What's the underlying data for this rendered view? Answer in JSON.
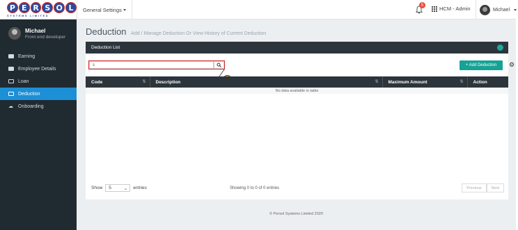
{
  "logo": {
    "letters": [
      "P",
      "E",
      "R",
      "S",
      "O",
      "L"
    ],
    "tagline": "SYSTEMS LIMITED"
  },
  "topbar": {
    "settings_label": "General Settings",
    "notification_count": "5",
    "role_label": "HCM - Admin",
    "user_label": "Michael"
  },
  "sidebar": {
    "user_name": "Michael",
    "user_role": "Front end developer",
    "items": [
      {
        "label": "Earning",
        "icon": "money-icon",
        "active": false
      },
      {
        "label": "Employee Details",
        "icon": "id-card-icon",
        "active": false
      },
      {
        "label": "Loan",
        "icon": "money-icon",
        "active": false
      },
      {
        "label": "Deduction",
        "icon": "list-icon",
        "active": true
      },
      {
        "label": "Onboarding",
        "icon": "cloud-upload-icon",
        "active": false
      }
    ]
  },
  "page": {
    "title": "Deduction",
    "subtitle": "Add / Manage Deduction Or View History of Current Deduction"
  },
  "panel": {
    "heading": "Deduction List",
    "search_value": "s",
    "add_button_label": "+ Add Deduction",
    "callout_number": "1"
  },
  "table": {
    "columns": [
      "Code",
      "Description",
      "Maximum Amount",
      "Action"
    ],
    "empty_message": "No data available in table"
  },
  "pagination": {
    "show_label": "Show",
    "page_size": "5",
    "entries_label": "entries",
    "summary": "Showing 0 to 0 of 0 entries",
    "previous_label": "Previous",
    "next_label": "Next"
  },
  "footer": {
    "copyright": "© Persol Systems Limited 2020"
  },
  "colors": {
    "accent": "#1c8fd6",
    "teal": "#16a395",
    "sidebar": "#202a31",
    "highlight": "#d12c2c"
  }
}
